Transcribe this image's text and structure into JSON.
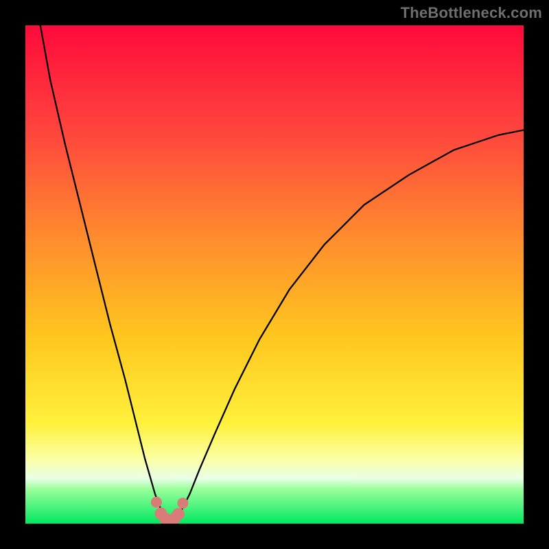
{
  "watermark": "TheBottleneck.com",
  "colors": {
    "frame": "#000000",
    "curve": "#000000",
    "marker_fill": "#d97c78",
    "marker_stroke": "#c65c5c",
    "gradient_stops": [
      {
        "pct": 0,
        "hex": "#ff0a3c"
      },
      {
        "pct": 22,
        "hex": "#ff473d"
      },
      {
        "pct": 42,
        "hex": "#ff8a2e"
      },
      {
        "pct": 63,
        "hex": "#ffc81e"
      },
      {
        "pct": 80,
        "hex": "#fff13c"
      },
      {
        "pct": 87,
        "hex": "#fbffa4"
      },
      {
        "pct": 91,
        "hex": "#e8ffe8"
      },
      {
        "pct": 93,
        "hex": "#9cff9c"
      },
      {
        "pct": 100,
        "hex": "#00e861"
      }
    ]
  },
  "chart_data": {
    "type": "line",
    "title": "",
    "xlabel": "",
    "ylabel": "",
    "xlim": [
      0,
      100
    ],
    "ylim": [
      0,
      100
    ],
    "grid": false,
    "legend": false,
    "series": [
      {
        "name": "bottleneck-curve",
        "x": [
          3,
          5,
          8,
          11,
          14,
          17,
          20,
          22,
          24,
          26,
          27.5,
          29,
          30,
          31,
          33,
          35,
          38,
          42,
          47,
          53,
          60,
          68,
          77,
          86,
          95,
          100
        ],
        "y": [
          100,
          89,
          76,
          64,
          52,
          40,
          29,
          21,
          13,
          6,
          2,
          0.5,
          0.7,
          2,
          6,
          11,
          18,
          27,
          37,
          47,
          56,
          64,
          70,
          75,
          78,
          79
        ]
      }
    ],
    "markers": {
      "name": "bottom-cluster",
      "x": [
        26.3,
        27.2,
        28.2,
        29.0,
        29.8,
        30.7,
        31.6
      ],
      "y": [
        4.3,
        2.0,
        0.9,
        0.6,
        0.9,
        1.9,
        4.1
      ]
    }
  }
}
